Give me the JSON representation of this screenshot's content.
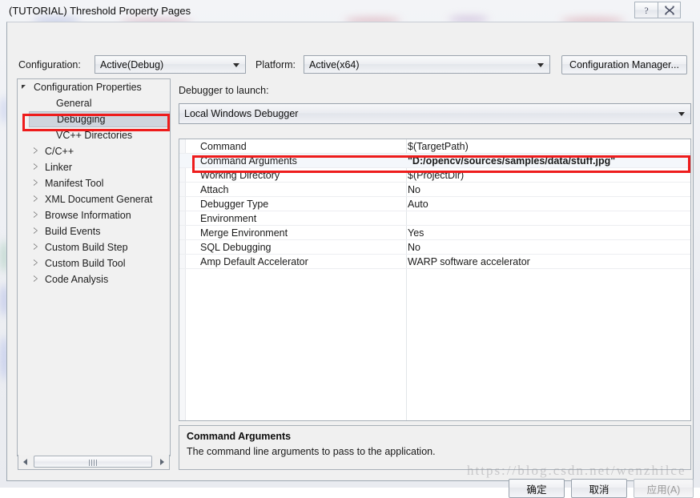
{
  "window": {
    "title": "(TUTORIAL) Threshold Property Pages",
    "help_icon": "question-mark-icon",
    "close_icon": "close-icon"
  },
  "toolbar": {
    "configuration_label": "Configuration:",
    "configuration_value": "Active(Debug)",
    "platform_label": "Platform:",
    "platform_value": "Active(x64)",
    "configuration_manager_label": "Configuration Manager..."
  },
  "debugger": {
    "launch_label": "Debugger to launch:",
    "launch_value": "Local Windows Debugger"
  },
  "tree": {
    "items": [
      {
        "label": "Configuration Properties",
        "indent": 0,
        "twisty": "expanded",
        "selected": false
      },
      {
        "label": "General",
        "indent": 1,
        "twisty": "none",
        "selected": false
      },
      {
        "label": "Debugging",
        "indent": 1,
        "twisty": "none",
        "selected": true
      },
      {
        "label": "VC++ Directories",
        "indent": 1,
        "twisty": "none",
        "selected": false
      },
      {
        "label": "C/C++",
        "indent": 1,
        "twisty": "collapsed",
        "selected": false
      },
      {
        "label": "Linker",
        "indent": 1,
        "twisty": "collapsed",
        "selected": false
      },
      {
        "label": "Manifest Tool",
        "indent": 1,
        "twisty": "collapsed",
        "selected": false
      },
      {
        "label": "XML Document Generat",
        "indent": 1,
        "twisty": "collapsed",
        "selected": false
      },
      {
        "label": "Browse Information",
        "indent": 1,
        "twisty": "collapsed",
        "selected": false
      },
      {
        "label": "Build Events",
        "indent": 1,
        "twisty": "collapsed",
        "selected": false
      },
      {
        "label": "Custom Build Step",
        "indent": 1,
        "twisty": "collapsed",
        "selected": false
      },
      {
        "label": "Custom Build Tool",
        "indent": 1,
        "twisty": "collapsed",
        "selected": false
      },
      {
        "label": "Code Analysis",
        "indent": 1,
        "twisty": "collapsed",
        "selected": false
      }
    ]
  },
  "grid": {
    "rows": [
      {
        "name": "Command",
        "value": "$(TargetPath)",
        "selected": false
      },
      {
        "name": "Command Arguments",
        "value": "\"D:/opencv/sources/samples/data/stuff.jpg\"",
        "selected": true
      },
      {
        "name": "Working Directory",
        "value": "$(ProjectDir)",
        "selected": false
      },
      {
        "name": "Attach",
        "value": "No",
        "selected": false
      },
      {
        "name": "Debugger Type",
        "value": "Auto",
        "selected": false
      },
      {
        "name": "Environment",
        "value": "",
        "selected": false
      },
      {
        "name": "Merge Environment",
        "value": "Yes",
        "selected": false
      },
      {
        "name": "SQL Debugging",
        "value": "No",
        "selected": false
      },
      {
        "name": "Amp Default Accelerator",
        "value": "WARP software accelerator",
        "selected": false
      }
    ]
  },
  "description": {
    "title": "Command Arguments",
    "text": "The command line arguments to pass to the application."
  },
  "buttons": {
    "ok": "确定",
    "cancel": "取消",
    "apply": "应用(A)"
  },
  "watermark": "https://blog.csdn.net/wenzhilce",
  "colors": {
    "annotation_red": "#ee1c1c",
    "selection_blue_gray": "#cfd5de",
    "dialog_face": "#f0f0f0"
  }
}
